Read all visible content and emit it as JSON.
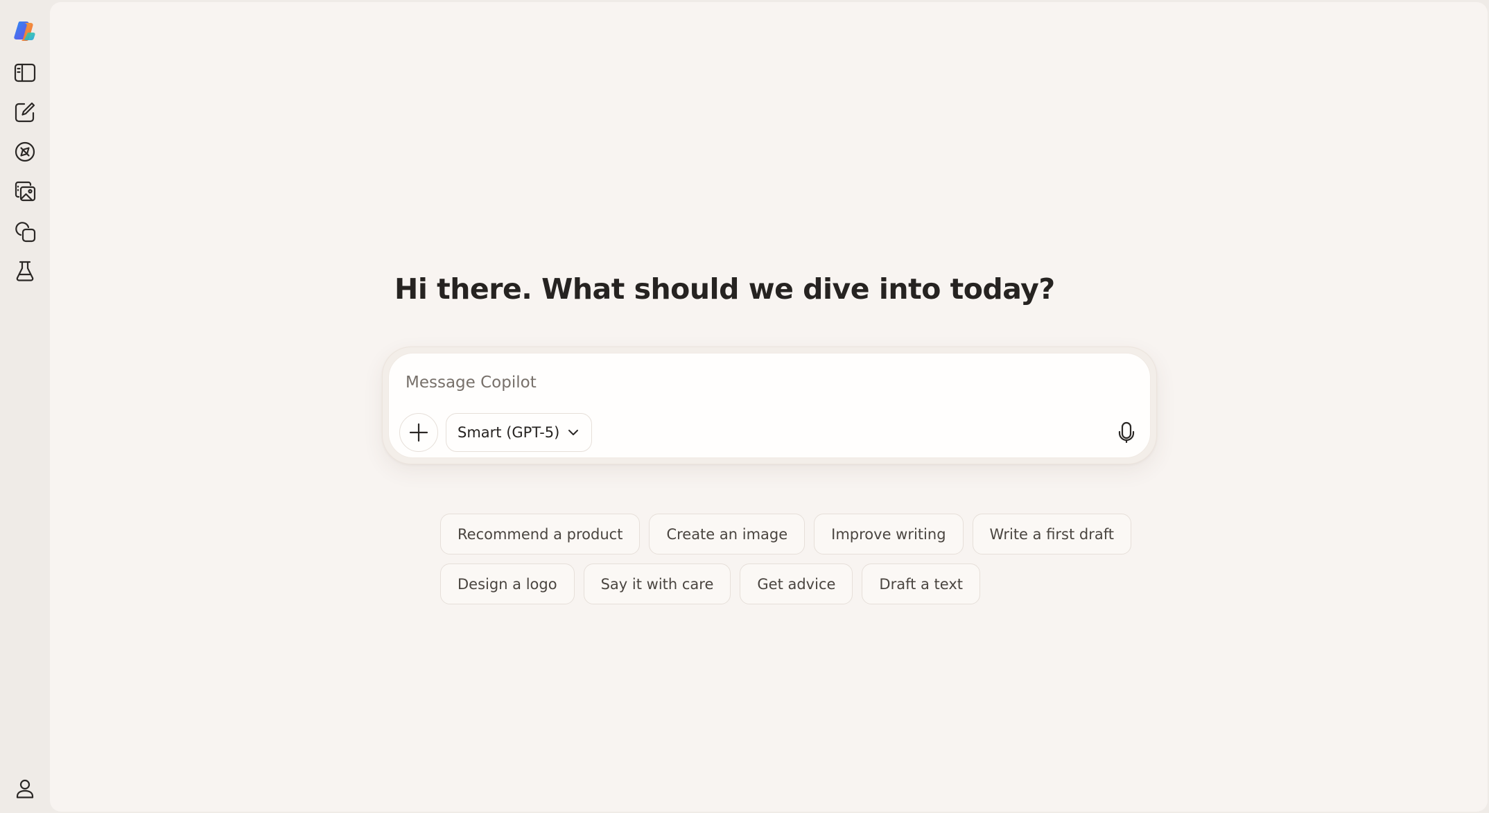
{
  "app": {
    "name": "Copilot",
    "colors": {
      "sidebar_bg": "#efebe7",
      "main_bg": "#f8f4f1",
      "text": "#262321",
      "chip_text": "#4a4540"
    }
  },
  "sidebar": {
    "logo_icon": "copilot-logo-icon",
    "items": [
      {
        "id": "toggle-sidebar",
        "icon": "sidebar-panel-icon"
      },
      {
        "id": "new-chat",
        "icon": "compose-icon"
      },
      {
        "id": "discover",
        "icon": "compass-icon"
      },
      {
        "id": "imagine",
        "icon": "image-gallery-icon"
      },
      {
        "id": "pages",
        "icon": "pages-icon"
      },
      {
        "id": "labs",
        "icon": "flask-icon"
      }
    ],
    "profile_icon": "user-icon"
  },
  "main": {
    "greeting": "Hi there. What should we dive into today?",
    "composer": {
      "placeholder": "Message Copilot",
      "value": "",
      "model_selected": "Smart (GPT-5)"
    },
    "suggestions_row1": [
      "Recommend a product",
      "Create an image",
      "Improve writing",
      "Write a first draft"
    ],
    "suggestions_row2": [
      "Design a logo",
      "Say it with care",
      "Get advice",
      "Draft a text"
    ]
  }
}
